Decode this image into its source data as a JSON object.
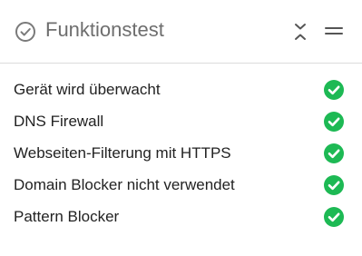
{
  "widget": {
    "title": "Funktionstest",
    "header_icon": "circle-check-icon",
    "collapse_icon": "collapse-arrows-icon",
    "menu_icon": "menu-icon"
  },
  "items": [
    {
      "label": "Gerät wird überwacht",
      "status": "ok",
      "status_icon": "green-check-icon"
    },
    {
      "label": "DNS Firewall",
      "status": "ok",
      "status_icon": "green-check-icon"
    },
    {
      "label": "Webseiten-Filterung mit HTTPS",
      "status": "ok",
      "status_icon": "green-check-icon"
    },
    {
      "label": "Domain Blocker nicht verwendet",
      "status": "ok",
      "status_icon": "green-check-icon"
    },
    {
      "label": "Pattern Blocker",
      "status": "ok",
      "status_icon": "green-check-icon"
    }
  ],
  "colors": {
    "title": "#6e6e6e",
    "text": "#222222",
    "ok": "#1db954",
    "divider": "#dcdcdc"
  }
}
